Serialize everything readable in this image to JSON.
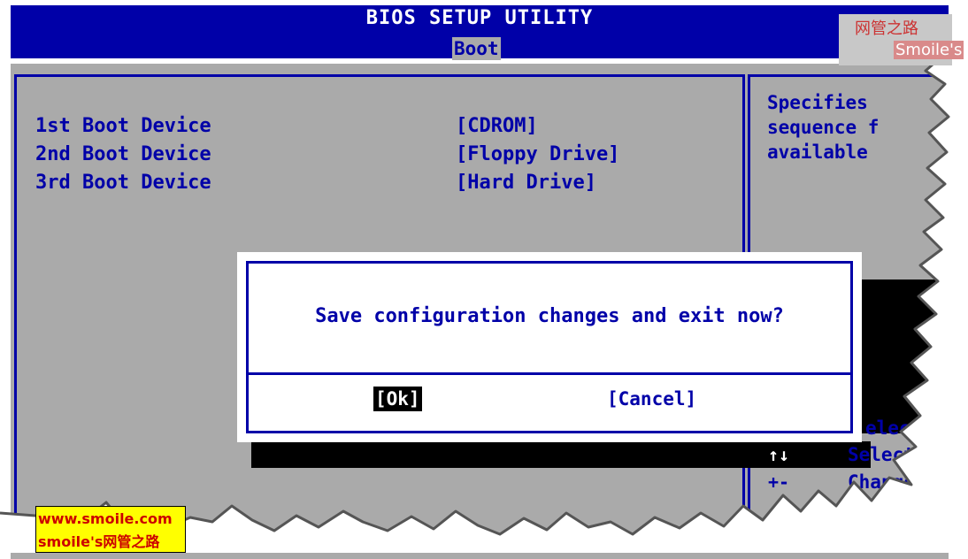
{
  "header": {
    "title": "BIOS SETUP UTILITY",
    "active_tab": "Boot"
  },
  "boot_devices": [
    {
      "label": "1st Boot Device",
      "value": "[CDROM]"
    },
    {
      "label": "2nd Boot Device",
      "value": "[Floppy Drive]"
    },
    {
      "label": "3rd Boot Device",
      "value": "[Hard Drive]"
    }
  ],
  "help_panel": {
    "lines": [
      "Specifies",
      "sequence f",
      "available"
    ]
  },
  "key_help": [
    {
      "glyph": "",
      "text": "elect S"
    },
    {
      "glyph": "↑↓",
      "text": "Select I"
    },
    {
      "glyph": "+-",
      "text": "Change"
    }
  ],
  "dialog": {
    "message": "Save configuration changes and exit now?",
    "ok_label": "[Ok]",
    "cancel_label": "[Cancel]"
  },
  "watermarks": {
    "top_cn": "网管之路",
    "top_en": "Smoile's",
    "bottom_line1": "www.smoile.com",
    "bottom_line2": "smoile's网管之路"
  },
  "colors": {
    "bios_blue": "#0000a8",
    "panel_gray": "#aaaaaa",
    "dialog_white": "#ffffff",
    "selected_black": "#000000",
    "watermark_yellow": "#ffff00"
  }
}
